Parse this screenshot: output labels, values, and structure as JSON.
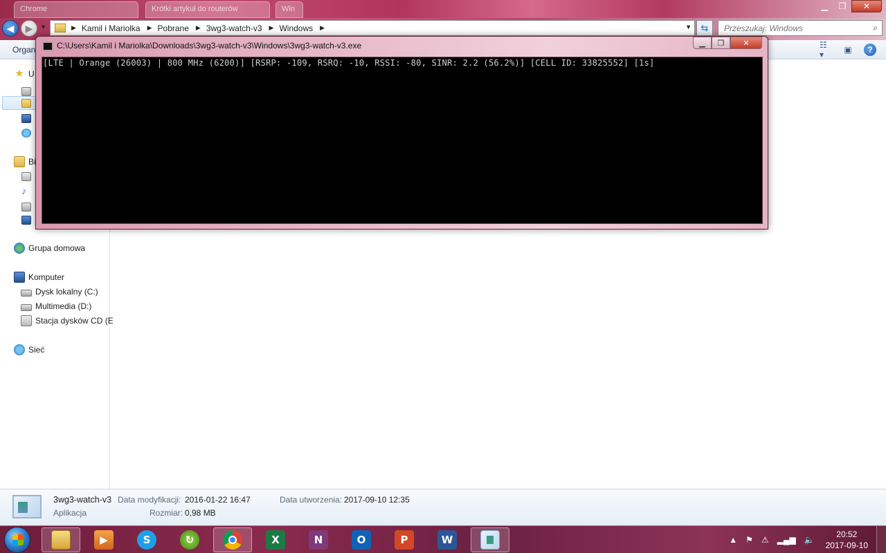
{
  "browser_tabs": [
    "Chrome",
    "Krótki artykuł do routerów",
    "Win"
  ],
  "explorer": {
    "breadcrumb": [
      "Kamil i Mariolka",
      "Pobrane",
      "3wg3-watch-v3",
      "Windows"
    ],
    "search_placeholder": "Przeszukaj: Windows",
    "toolbar": {
      "organize": "Organ"
    },
    "nav": {
      "favorites_label": "U",
      "libraries_label": "Bi",
      "homegroup": "Grupa domowa",
      "computer": "Komputer",
      "drives": [
        "Dysk lokalny (C:)",
        "Multimedia (D:)",
        "Stacja dysków CD (E"
      ],
      "network": "Sieć"
    },
    "details": {
      "file_name": "3wg3-watch-v3",
      "file_type": "Aplikacja",
      "modified_label": "Data modyfikacji:",
      "modified_value": "2016-01-22 16:47",
      "created_label": "Data utworzenia:",
      "created_value": "2017-09-10 12:35",
      "size_label": "Rozmiar:",
      "size_value": "0,98 MB"
    }
  },
  "console": {
    "title": "C:\\Users\\Kamil i Mariolka\\Downloads\\3wg3-watch-v3\\Windows\\3wg3-watch-v3.exe",
    "output": "[LTE | Orange (26003) | 800 MHz (6200)] [RSRP: -109, RSRQ: -10, RSSI: -80, SINR: 2.2 (56.2%)] [CELL ID: 33825552] [1s]"
  },
  "taskbar": {
    "apps": [
      {
        "name": "Eksplorator Windows",
        "icon": "explorer-icon"
      },
      {
        "name": "Media",
        "icon": "media-player-icon"
      },
      {
        "name": "Skype",
        "icon": "skype-icon"
      },
      {
        "name": "Zapis",
        "icon": "recycle-icon"
      },
      {
        "name": "Google Chrome",
        "icon": "chrome-icon"
      },
      {
        "name": "Excel",
        "icon": "excel-icon",
        "letter": "X"
      },
      {
        "name": "OneNote",
        "icon": "onenote-icon",
        "letter": "N"
      },
      {
        "name": "Outlook",
        "icon": "outlook-icon",
        "letter": "O"
      },
      {
        "name": "PowerPoint",
        "icon": "powerpoint-icon",
        "letter": "P"
      },
      {
        "name": "Word",
        "icon": "word-icon",
        "letter": "W"
      },
      {
        "name": "3wg3-watch-v3",
        "icon": "console-app-icon"
      }
    ],
    "clock_time": "20:52",
    "clock_date": "2017-09-10"
  },
  "colors": {
    "aero_accent": "#b0355c",
    "console_bg": "#000000",
    "console_text": "#cfcfcf"
  }
}
